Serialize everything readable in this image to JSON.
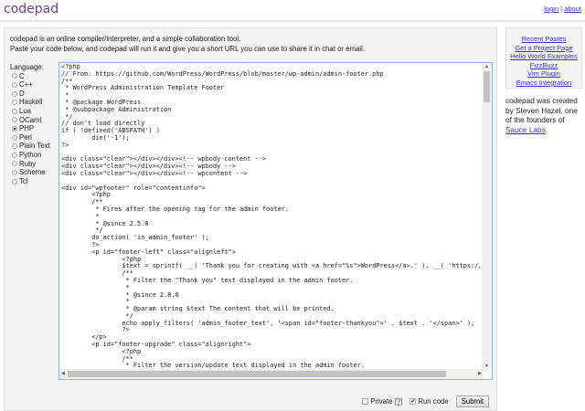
{
  "header": {
    "logo": "codepad",
    "login": "login",
    "separator": "|",
    "about": "about"
  },
  "intro": {
    "line1": "codepad is an online compiler/interpreter, and a simple collaboration tool.",
    "line2": "Paste your code below, and codepad will run it and give you a short URL you can use to share it in chat or email."
  },
  "languages": {
    "label": "Language:",
    "selected": "PHP",
    "items": [
      "C",
      "C++",
      "D",
      "Haskell",
      "Lua",
      "OCaml",
      "PHP",
      "Perl",
      "Plain Text",
      "Python",
      "Ruby",
      "Scheme",
      "Tcl"
    ]
  },
  "editor": {
    "code": "<?php\n// From: https://github.com/WordPress/WordPress/blob/master/wp-admin/admin-footer.php\n/**\n * WordPress Administration Template Footer\n *\n * @package WordPress\n * @subpackage Administration\n */\n// don't load directly\nif ( !defined('ABSPATH') )\n\tdie('-1');\n?>\n\n<div class=\"clear\"></div></div><!-- wpbody-content -->\n<div class=\"clear\"></div></div><!-- wpbody -->\n<div class=\"clear\"></div></div><!-- wpcontent -->\n\n<div id=\"wpfooter\" role=\"contentinfo\">\n\t<?php\n\t/**\n\t * Fires after the opening tag for the admin footer.\n\t *\n\t * @since 2.5.0\n\t */\n\tdo_action( 'in_admin_footer' );\n\t?>\n\t<p id=\"footer-left\" class=\"alignleft\">\n\t\t<?php\n\t\t$text = sprintf( __( 'Thank you for creating with <a href=\"%s\">WordPress</a>.' ), __( 'https://wordpress.org/' ) );\n\t\t/**\n\t\t * Filter the \"Thank you\" text displayed in the admin footer.\n\t\t *\n\t\t * @since 2.8.0\n\t\t *\n\t\t * @param string $text The content that will be printed.\n\t\t */\n\t\techo apply_filters( 'admin_footer_text', '<span id=\"footer-thankyou\">' . $text . '</span>' );\n\t\t?>\n\t</p>\n\t<p id=\"footer-upgrade\" class=\"alignright\">\n\t\t<?php\n\t\t/**\n\t\t * Filter the version/update text displayed in the admin footer.\n\t\t *"
  },
  "controls": {
    "private_label": "Private",
    "private_help": "[?]",
    "private_checked": false,
    "run_label": "Run code",
    "run_checked": true,
    "submit": "Submit"
  },
  "sidebar": {
    "links": [
      "Recent Pastes",
      "Get a Project Page",
      "Hello World Examples",
      "FizzBuzz",
      "Vim Plugin",
      "Emacs Integration"
    ],
    "credit_text": "codepad was created by Steven Hazel, one of the founders of ",
    "credit_link": "Sauce Labs",
    "credit_end": "."
  }
}
